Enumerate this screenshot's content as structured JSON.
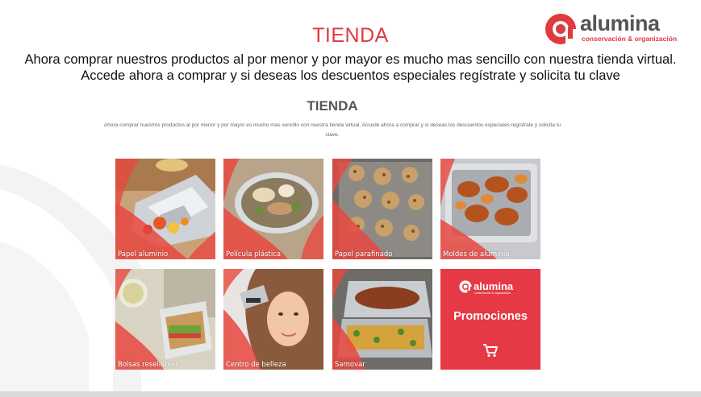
{
  "header": {
    "title": "TIENDA",
    "subtitle": "Ahora comprar nuestros productos al por menor y por mayor es mucho mas sencillo con nuestra tienda virtual. Accede ahora a comprar y si deseas los descuentos especiales regístrate y solicita tu clave"
  },
  "logo": {
    "name": "alumina",
    "tagline": "conservación & organización"
  },
  "store": {
    "title": "TIENDA",
    "text": "Ahora comprar nuestros productos al por menor y por mayor es mucho mas sencillo con nuestra tienda virtual. Accede ahora a comprar y si deseas los descuentos especiales regístrate y solicita tu clave."
  },
  "products": [
    {
      "label": "Papel aluminio",
      "icon": "foil-photo"
    },
    {
      "label": "Película plástica",
      "icon": "film-photo"
    },
    {
      "label": "Papel parafinado",
      "icon": "cookies-photo"
    },
    {
      "label": "Moldes de aluminio",
      "icon": "tray-photo"
    },
    {
      "label": "Bolsas resellables",
      "icon": "bag-photo"
    },
    {
      "label": "Centro de belleza",
      "icon": "beauty-photo"
    },
    {
      "label": "Samovar",
      "icon": "samovar-photo"
    }
  ],
  "promo": {
    "logo_name": "alumina",
    "logo_tagline": "conservación & organización",
    "title": "Promociones",
    "icon": "cart-icon"
  },
  "colors": {
    "brand_red": "#e0393e",
    "promo_red": "#e53945",
    "text_gray": "#555555"
  }
}
